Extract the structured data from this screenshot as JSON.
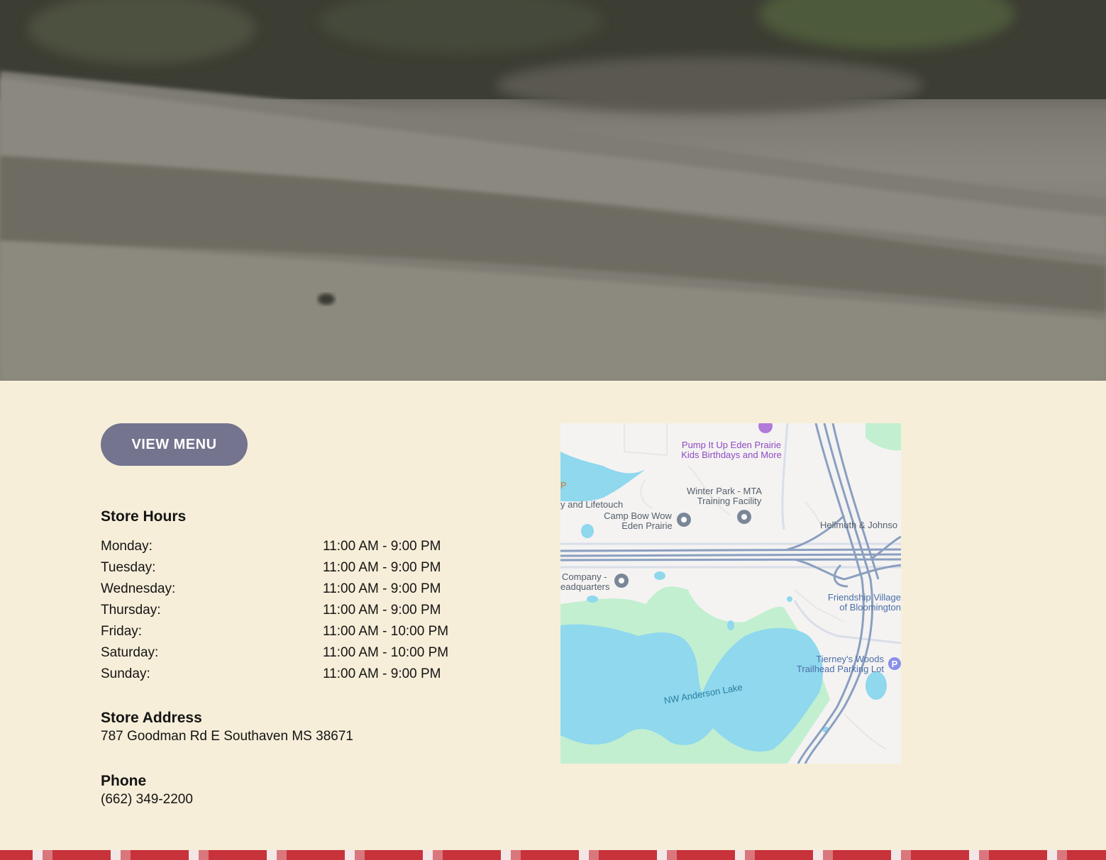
{
  "hero": {
    "image": "blurred photo of concrete curb and grass"
  },
  "actions": {
    "view_menu_label": "VIEW MENU"
  },
  "hours": {
    "heading": "Store Hours",
    "rows": [
      {
        "day": "Monday:",
        "time": "11:00 AM - 9:00 PM"
      },
      {
        "day": "Tuesday:",
        "time": "11:00 AM - 9:00 PM"
      },
      {
        "day": "Wednesday:",
        "time": "11:00 AM - 9:00 PM"
      },
      {
        "day": "Thursday:",
        "time": "11:00 AM - 9:00 PM"
      },
      {
        "day": "Friday:",
        "time": "11:00 AM - 10:00 PM"
      },
      {
        "day": "Saturday:",
        "time": "11:00 AM - 10:00 PM"
      },
      {
        "day": "Sunday:",
        "time": "11:00 AM - 9:00 PM"
      }
    ]
  },
  "address": {
    "heading": "Store Address",
    "value": "787 Goodman Rd E Southaven MS 38671"
  },
  "phone": {
    "heading": "Phone",
    "value": "(662) 349-2200"
  },
  "map": {
    "labels": {
      "pump_line1": "Pump It Up Eden Prairie",
      "pump_line2": "Kids Birthdays and More",
      "winter_line1": "Winter Park - MTA",
      "winter_line2": "Training Facility",
      "lifetouch": "y and Lifetouch",
      "camp_line1": "Camp Bow Wow",
      "camp_line2": "Eden Prairie",
      "hellmuth": "Hellmuth & Johnso",
      "company_line1": "Company -",
      "company_line2": "eadquarters",
      "friendship_line1": "Friendship Village",
      "friendship_line2": "of Bloomington",
      "tierney_line1": "Tierney's Woods",
      "tierney_line2": "Trailhead Parking Lot",
      "lake": "NW Anderson Lake",
      "edge_p": "P",
      "parking_p": "P"
    },
    "colors": {
      "water": "#8fd8ee",
      "park": "#c2efd0",
      "highway": "#8a9fc0",
      "poi_purple": "#8f4ac2",
      "label_blue": "#4b6ea8"
    }
  },
  "colors": {
    "background": "#f7eed9",
    "button": "#74748f",
    "text": "#141414",
    "footer_red": "#c8323a"
  }
}
